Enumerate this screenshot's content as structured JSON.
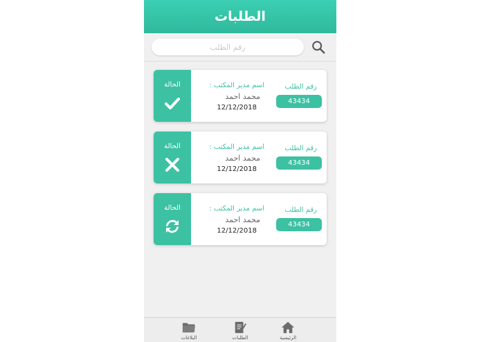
{
  "header": {
    "title": "الطلبات"
  },
  "search": {
    "placeholder": "رقم الطلب"
  },
  "requests": [
    {
      "status_label": "الحالة",
      "status_icon": "check-icon",
      "manager_label": "اسم مدير المكتب :",
      "manager_name": "محمد احمد",
      "date": "12/12/2018",
      "request_label": "رقم الطلب",
      "request_number": "43434"
    },
    {
      "status_label": "الحالة",
      "status_icon": "close-icon",
      "manager_label": "اسم مدير المكتب :",
      "manager_name": "محمد احمد",
      "date": "12/12/2018",
      "request_label": "رقم الطلب",
      "request_number": "43434"
    },
    {
      "status_label": "الحالة",
      "status_icon": "refresh-icon",
      "manager_label": "اسم مدير المكتب :",
      "manager_name": "محمد احمد",
      "date": "12/12/2018",
      "request_label": "رقم الطلب",
      "request_number": "43434"
    }
  ],
  "bottom_nav": {
    "items": [
      {
        "label": "البلاغات",
        "icon": "folder-icon"
      },
      {
        "label": "الطلبات",
        "icon": "document-icon"
      },
      {
        "label": "الرئيسية",
        "icon": "home-icon"
      }
    ]
  },
  "colors": {
    "accent": "#3cc1a3",
    "header_top": "#3ccfb3",
    "header_bottom": "#2fb99c",
    "background": "#f0f0f0",
    "nav_icon": "#6b6b6b"
  }
}
